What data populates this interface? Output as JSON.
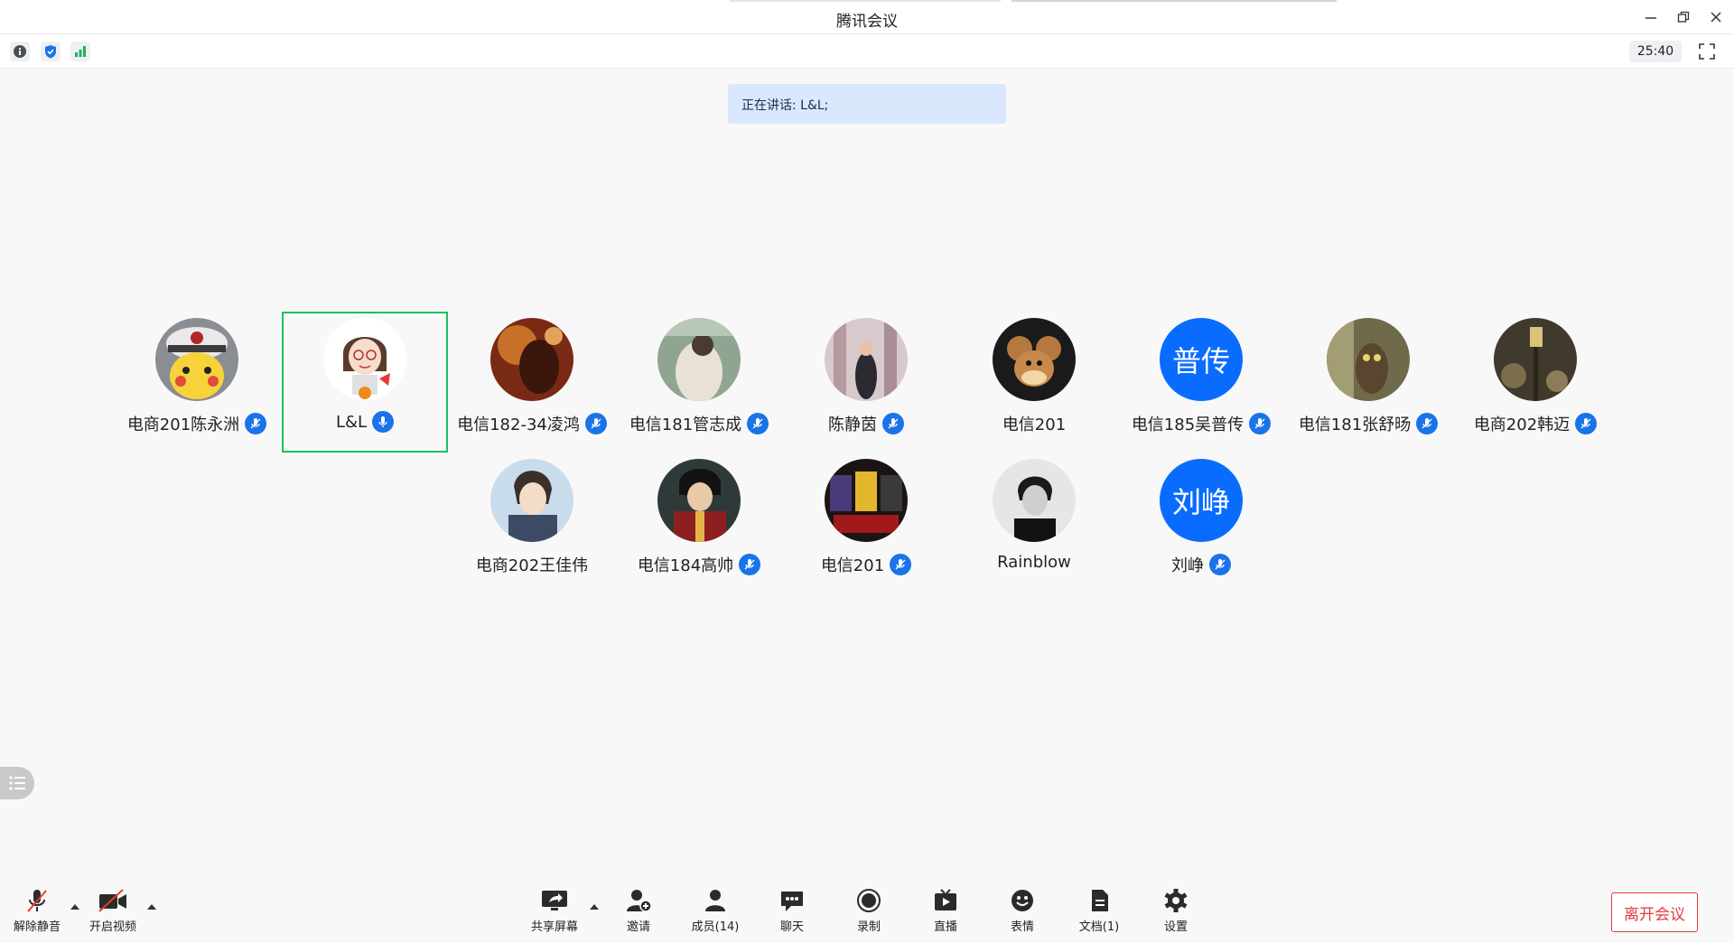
{
  "window": {
    "title": "腾讯会议"
  },
  "infobar": {
    "timer": "25:40",
    "icons": [
      "info-icon",
      "shield-icon",
      "signal-icon",
      "fullscreen-icon"
    ]
  },
  "speaking": {
    "text": "正在讲话: L&L;"
  },
  "participants": [
    {
      "name": "电商201陈永洲",
      "avatar": "pikachu",
      "muted_badge": true
    },
    {
      "name": "L&L",
      "avatar": "cartoon-girl",
      "muted_badge": true,
      "active_speaker": true
    },
    {
      "name": "电信182-34凌鸿",
      "avatar": "photo-warm",
      "muted_badge": true
    },
    {
      "name": "电信181管志成",
      "avatar": "photo-green",
      "muted_badge": true
    },
    {
      "name": "陈静茵",
      "avatar": "photo-street",
      "muted_badge": true
    },
    {
      "name": "电信201",
      "avatar": "jerry-mouse",
      "muted_badge": false
    },
    {
      "name": "电信185吴普传",
      "avatar_text": "普传",
      "muted_badge": true
    },
    {
      "name": "电信181张舒旸",
      "avatar": "photo-owl",
      "muted_badge": true
    },
    {
      "name": "电商202韩迈",
      "avatar": "photo-lamp",
      "muted_badge": true
    },
    {
      "name": "电商202王佳伟",
      "avatar": "anime-boy",
      "muted_badge": false
    },
    {
      "name": "电信184高帅",
      "avatar": "lupin",
      "muted_badge": true
    },
    {
      "name": "电信201",
      "avatar": "photo-jerseys",
      "muted_badge": true
    },
    {
      "name": "Rainblow",
      "avatar": "bw-portrait",
      "muted_badge": false
    },
    {
      "name": "刘峥",
      "avatar_text": "刘峥",
      "muted_badge": true
    }
  ],
  "toolbar": {
    "unmute": "解除静音",
    "start_video": "开启视频",
    "share_screen": "共享屏幕",
    "invite": "邀请",
    "members": "成员(14)",
    "chat": "聊天",
    "record": "录制",
    "live": "直播",
    "emoji": "表情",
    "docs": "文档(1)",
    "settings": "设置",
    "leave": "离开会议"
  },
  "colors": {
    "accent": "#1a73e8",
    "active_border": "#1fbf5e",
    "leave": "#e03b3b",
    "banner": "#d9e8fc"
  }
}
